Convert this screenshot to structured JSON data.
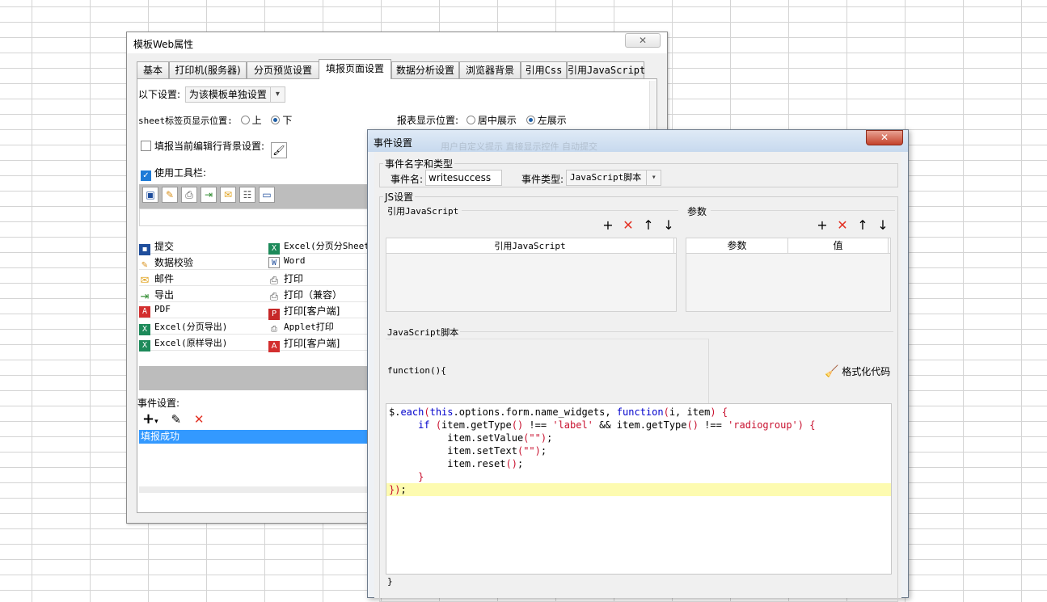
{
  "dialog1": {
    "title": "模板Web属性",
    "close": "✕",
    "tabs": [
      "基本",
      "打印机(服务器)",
      "分页预览设置",
      "填报页面设置",
      "数据分析设置",
      "浏览器背景",
      "引用Css",
      "引用JavaScript"
    ],
    "active_tab": "填报页面设置",
    "settings_label": "以下设置:",
    "settings_value": "为该模板单独设置",
    "sheet_pos_label": "sheet标签页显示位置:",
    "sheet_pos_up": "上",
    "sheet_pos_down": "下",
    "sheet_pos_selected": "下",
    "report_pos_label": "报表显示位置:",
    "report_pos_center": "居中展示",
    "report_pos_left": "左展示",
    "report_pos_selected": "左展示",
    "row_bg_label": "填报当前编辑行背景设置:",
    "row_bg_checked": false,
    "use_toolbar_label": "使用工具栏:",
    "use_toolbar_checked": true,
    "toolbar_items": [
      {
        "left": "提交",
        "right": "Excel(分页分Sheet"
      },
      {
        "left": "数据校验",
        "right": "Word"
      },
      {
        "left": "邮件",
        "right": "打印"
      },
      {
        "left": "导出",
        "right": "打印（兼容）"
      },
      {
        "left": "PDF",
        "right": "打印[客户端]"
      },
      {
        "left": "Excel(分页导出)",
        "right": "Applet打印"
      },
      {
        "left": "Excel(原样导出)",
        "right": "打印[客户端]"
      }
    ],
    "event_settings_label": "事件设置:",
    "events": [
      "填报成功"
    ],
    "selected_event": "填报成功"
  },
  "dialog2": {
    "title": "事件设置",
    "ghost_text": "用户自定义提示  直接显示控件  自动提交",
    "close": "✕",
    "name_type_group": "事件名字和类型",
    "event_name_label": "事件名:",
    "event_name_value": "writesuccess",
    "event_type_label": "事件类型:",
    "event_type_value": "JavaScript脚本",
    "js_group": "JS设置",
    "ref_js_label": "引用JavaScript",
    "params_label": "参数",
    "ref_js_column": "引用JavaScript",
    "param_columns": [
      "参数",
      "值"
    ],
    "script_label": "JavaScript脚本",
    "function_header": "function(){",
    "format_button": "格式化代码",
    "closing_brace": "}",
    "code_lines": [
      "$.each(this.options.form.name_widgets, function(i, item) {",
      "     if (item.getType() !== 'label' && item.getType() !== 'radiogroup') {",
      "          item.setValue(\"\");",
      "          item.setText(\"\");",
      "          item.reset();",
      "     }",
      "});"
    ],
    "highlighted_line": 7
  },
  "icons": {
    "add": "+",
    "delete": "✕",
    "up": "↑",
    "down": "↓",
    "edit": "✎"
  },
  "colors": {
    "selection": "#3399ff",
    "delete_red": "#e33325",
    "keyword_blue": "#0000cc",
    "string_red": "#c8102e",
    "highlight_line": "#fdfbb0"
  }
}
